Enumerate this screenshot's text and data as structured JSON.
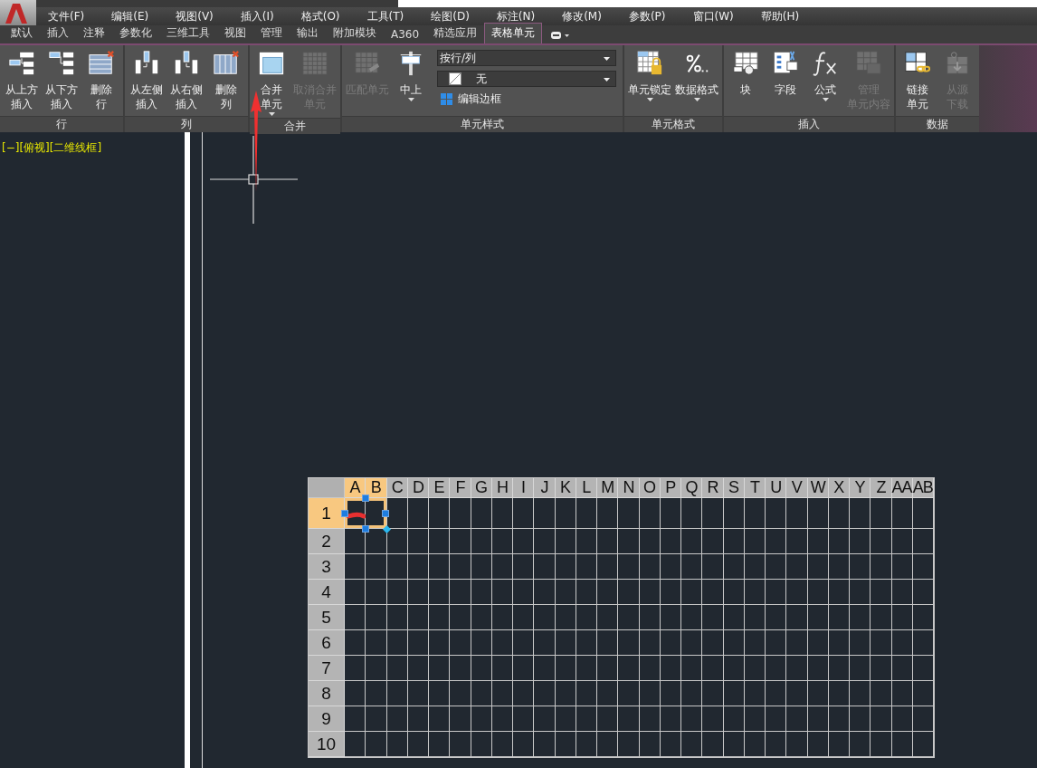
{
  "menu_bar": {
    "items": [
      "文件(F)",
      "编辑(E)",
      "视图(V)",
      "插入(I)",
      "格式(O)",
      "工具(T)",
      "绘图(D)",
      "标注(N)",
      "修改(M)",
      "参数(P)",
      "窗口(W)",
      "帮助(H)"
    ]
  },
  "ribbon_tabs": [
    {
      "label": "默认",
      "selected": false
    },
    {
      "label": "插入",
      "selected": false
    },
    {
      "label": "注释",
      "selected": false
    },
    {
      "label": "参数化",
      "selected": false
    },
    {
      "label": "三维工具",
      "selected": false
    },
    {
      "label": "视图",
      "selected": false
    },
    {
      "label": "管理",
      "selected": false
    },
    {
      "label": "输出",
      "selected": false
    },
    {
      "label": "附加模块",
      "selected": false
    },
    {
      "label": "A360",
      "selected": false
    },
    {
      "label": "精选应用",
      "selected": false
    },
    {
      "label": "表格单元",
      "selected": true
    }
  ],
  "ribbon_panels": [
    {
      "title": "行",
      "items": [
        {
          "kind": "large",
          "lines": [
            "从上方",
            "插入"
          ],
          "disabled": false,
          "dropdown": false
        },
        {
          "kind": "large",
          "lines": [
            "从下方",
            "插入"
          ],
          "disabled": false,
          "dropdown": false
        },
        {
          "kind": "large",
          "lines": [
            "删除",
            "行"
          ],
          "disabled": false,
          "dropdown": false
        }
      ]
    },
    {
      "title": "列",
      "items": [
        {
          "kind": "large",
          "lines": [
            "从左侧",
            "插入"
          ],
          "disabled": false,
          "dropdown": false
        },
        {
          "kind": "large",
          "lines": [
            "从右侧",
            "插入"
          ],
          "disabled": false,
          "dropdown": false
        },
        {
          "kind": "large",
          "lines": [
            "删除",
            "列"
          ],
          "disabled": false,
          "dropdown": false
        }
      ]
    },
    {
      "title": "合并",
      "items": [
        {
          "kind": "large",
          "lines": [
            "合并",
            "单元"
          ],
          "disabled": false,
          "dropdown": true
        },
        {
          "kind": "large",
          "lines": [
            "取消合并",
            "单元"
          ],
          "disabled": true,
          "dropdown": false
        }
      ]
    },
    {
      "title": "单元样式",
      "items": [
        {
          "kind": "large",
          "lines": [
            "匹配单元"
          ],
          "disabled": true,
          "dropdown": false
        },
        {
          "kind": "large",
          "lines": [
            "中上"
          ],
          "disabled": false,
          "dropdown": true
        },
        {
          "kind": "combo",
          "value": "按行/列",
          "swatch": false
        },
        {
          "kind": "combo",
          "value": "无",
          "swatch": true
        },
        {
          "kind": "small",
          "label": "编辑边框"
        }
      ]
    },
    {
      "title": "单元格式",
      "items": [
        {
          "kind": "large",
          "lines": [
            "单元锁定"
          ],
          "disabled": false,
          "dropdown": true
        },
        {
          "kind": "large",
          "lines": [
            "数据格式"
          ],
          "disabled": false,
          "dropdown": true
        }
      ]
    },
    {
      "title": "插入",
      "items": [
        {
          "kind": "large",
          "lines": [
            "块"
          ],
          "disabled": false,
          "dropdown": false
        },
        {
          "kind": "large",
          "lines": [
            "字段"
          ],
          "disabled": false,
          "dropdown": false
        },
        {
          "kind": "large",
          "lines": [
            "公式"
          ],
          "disabled": false,
          "dropdown": true
        },
        {
          "kind": "large",
          "lines": [
            "管理",
            "单元内容"
          ],
          "disabled": true,
          "dropdown": false
        }
      ]
    },
    {
      "title": "数据",
      "items": [
        {
          "kind": "large",
          "lines": [
            "链接",
            "单元"
          ],
          "disabled": false,
          "dropdown": false
        },
        {
          "kind": "large",
          "lines": [
            "从源",
            "下载"
          ],
          "disabled": true,
          "dropdown": false
        }
      ]
    }
  ],
  "viewport": {
    "label": "[−][俯视][二维线框]"
  },
  "table": {
    "columns": [
      {
        "label": "A",
        "selected": true
      },
      {
        "label": "B",
        "selected": true
      },
      {
        "label": "C",
        "selected": false
      },
      {
        "label": "D",
        "selected": false
      },
      {
        "label": "E",
        "selected": false
      },
      {
        "label": "F",
        "selected": false
      },
      {
        "label": "G",
        "selected": false
      },
      {
        "label": "H",
        "selected": false
      },
      {
        "label": "I",
        "selected": false
      },
      {
        "label": "J",
        "selected": false
      },
      {
        "label": "K",
        "selected": false
      },
      {
        "label": "L",
        "selected": false
      },
      {
        "label": "M",
        "selected": false
      },
      {
        "label": "N",
        "selected": false
      },
      {
        "label": "O",
        "selected": false
      },
      {
        "label": "P",
        "selected": false
      },
      {
        "label": "Q",
        "selected": false
      },
      {
        "label": "R",
        "selected": false
      },
      {
        "label": "S",
        "selected": false
      },
      {
        "label": "T",
        "selected": false
      },
      {
        "label": "U",
        "selected": false
      },
      {
        "label": "V",
        "selected": false
      },
      {
        "label": "W",
        "selected": false
      },
      {
        "label": "X",
        "selected": false
      },
      {
        "label": "Y",
        "selected": false
      },
      {
        "label": "Z",
        "selected": false
      },
      {
        "label": "AA",
        "selected": false
      },
      {
        "label": "AB",
        "selected": false
      }
    ],
    "rows": [
      {
        "label": "1",
        "selected": true
      },
      {
        "label": "2",
        "selected": false
      },
      {
        "label": "3",
        "selected": false
      },
      {
        "label": "4",
        "selected": false
      },
      {
        "label": "5",
        "selected": false
      },
      {
        "label": "6",
        "selected": false
      },
      {
        "label": "7",
        "selected": false
      },
      {
        "label": "8",
        "selected": false
      },
      {
        "label": "9",
        "selected": false
      },
      {
        "label": "10",
        "selected": false
      }
    ]
  }
}
